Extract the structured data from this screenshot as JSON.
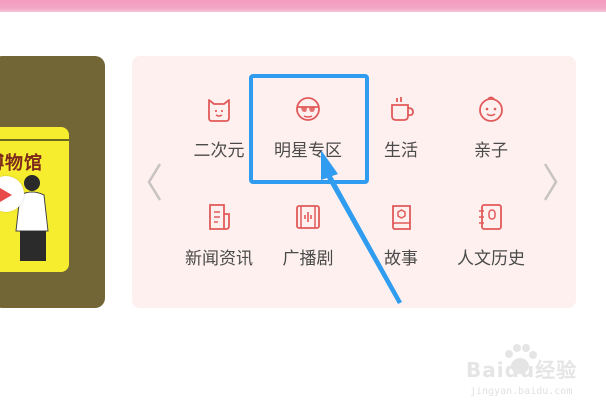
{
  "banner": {
    "cover_title": "博物馆",
    "bg_color": "#726636",
    "cover_color": "#f7ed2f"
  },
  "categories": {
    "nav": {
      "prev_icon": "chevron-left-icon",
      "next_icon": "chevron-right-icon"
    },
    "row1": [
      {
        "label": "二次元",
        "icon": "anime-cat-icon"
      },
      {
        "label": "明星专区",
        "icon": "star-sunglasses-icon"
      },
      {
        "label": "生活",
        "icon": "cup-icon"
      },
      {
        "label": "亲子",
        "icon": "baby-face-icon"
      }
    ],
    "row2": [
      {
        "label": "新闻资讯",
        "icon": "news-doc-icon"
      },
      {
        "label": "广播剧",
        "icon": "film-audio-icon"
      },
      {
        "label": "故事",
        "icon": "book-icon"
      },
      {
        "label": "人文历史",
        "icon": "notebook-icon"
      }
    ]
  },
  "annotation": {
    "color": "#2f9cf0"
  },
  "watermark": {
    "brand": "Baidu经验",
    "url": "jingyan.baidu.com"
  },
  "colors": {
    "accent": "#e25a5a",
    "panel": "#fdf0ef",
    "top_bar": "#f59bc0"
  }
}
